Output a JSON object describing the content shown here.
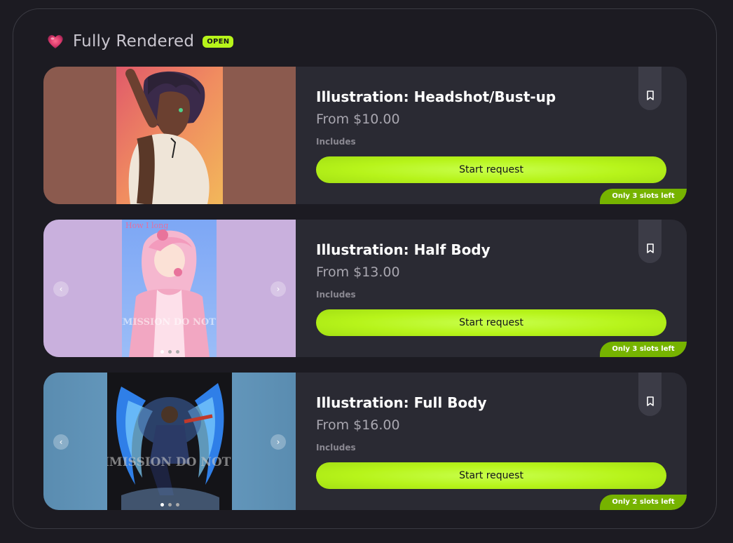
{
  "section": {
    "title": "Fully Rendered",
    "badge": "OPEN",
    "icon": "heart-icon",
    "accent": "#b7f41a"
  },
  "cards": [
    {
      "title": "Illustration: Headshot/Bust-up",
      "price": "From $10.00",
      "includes_label": "Includes",
      "button_label": "Start request",
      "slots_label": "Only 3 slots left",
      "bg_color": "#8b5a4e",
      "has_carousel": false
    },
    {
      "title": "Illustration: Half Body",
      "price": "From $13.00",
      "includes_label": "Includes",
      "button_label": "Start request",
      "slots_label": "Only 3 slots left",
      "bg_color": "#c9b0dd",
      "has_carousel": true,
      "art_text": "How I long",
      "watermark": "COMMISSION DO NOT USE"
    },
    {
      "title": "Illustration: Full Body",
      "price": "From $16.00",
      "includes_label": "Includes",
      "button_label": "Start request",
      "slots_label": "Only 2 slots left",
      "bg_color": "#5e8fb2",
      "has_carousel": true,
      "watermark": "COMMISSION DO NOT USE"
    }
  ]
}
